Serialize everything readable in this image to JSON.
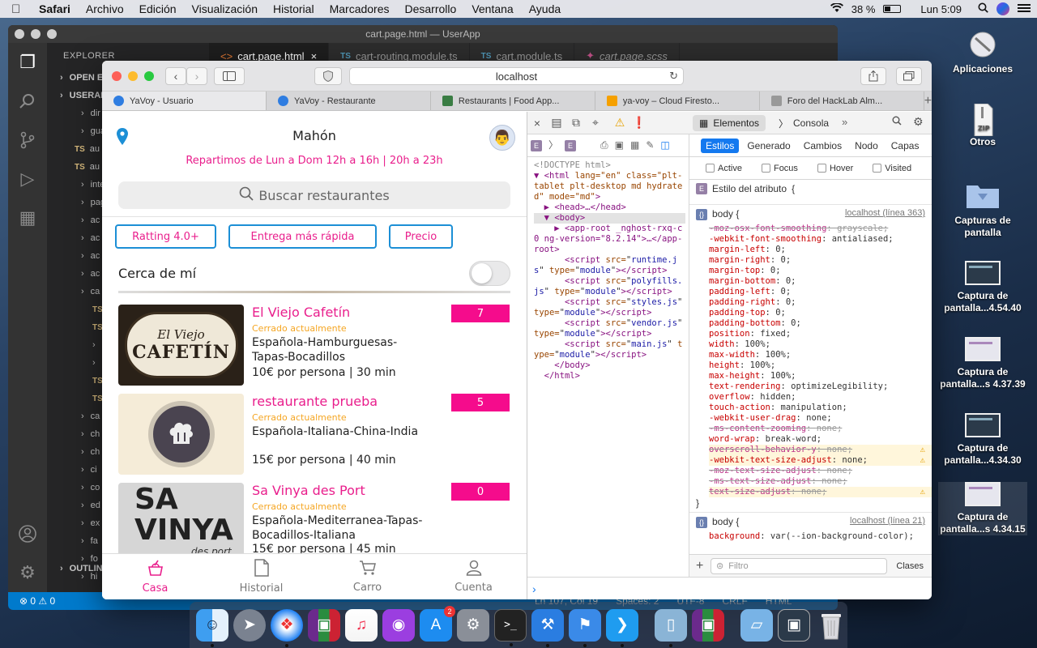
{
  "menubar": {
    "app": "Safari",
    "items": [
      "Archivo",
      "Edición",
      "Visualización",
      "Historial",
      "Marcadores",
      "Desarrollo",
      "Ventana",
      "Ayuda"
    ],
    "battery": "38 %",
    "clock": "Lun 5:09"
  },
  "desktop": {
    "icons": [
      {
        "label": "Aplicaciones"
      },
      {
        "label": "Otros"
      },
      {
        "label": "Capturas de pantalla"
      },
      {
        "label": "Captura de pantalla...4.54.40"
      },
      {
        "label": "Captura de pantalla...s 4.37.39"
      },
      {
        "label": "Captura de pantalla...4.34.30"
      },
      {
        "label": "Captura de pantalla...s 4.34.15"
      }
    ]
  },
  "vscode": {
    "title": "cart.page.html — UserApp",
    "explorer": "EXPLORER",
    "sidebar_rows": [
      "OPEN ED",
      "USERAP",
      "dir",
      "gua",
      "au",
      "au",
      "inte",
      "pag",
      "ac",
      "ac",
      "ac",
      "ac",
      "ca",
      "",
      "",
      "",
      "",
      "",
      "",
      "ca",
      "ch",
      "ch",
      "ci",
      "co",
      "ed",
      "ex",
      "fa",
      "fo",
      "hi",
      "OUTLINE"
    ],
    "tabs": [
      "cart.page.html",
      "cart-routing.module.ts",
      "cart.module.ts",
      "cart.page.scss"
    ],
    "status_left": "⊗ 0 ⚠ 0",
    "status_right": [
      "Ln 107, Col 19",
      "Spaces: 2",
      "UTF-8",
      "CRLF",
      "HTML"
    ]
  },
  "safari": {
    "url": "localhost",
    "tabs": [
      {
        "label": "YaVoy - Usuario",
        "color": "#2f7de1"
      },
      {
        "label": "YaVoy - Restaurante",
        "color": "#2f7de1"
      },
      {
        "label": "Restaurants | Food App...",
        "color": "#3a7d44"
      },
      {
        "label": "ya-voy – Cloud Firesto...",
        "color": "#f5a000"
      },
      {
        "label": "Foro del HackLab Alm...",
        "color": "#999999"
      }
    ]
  },
  "app": {
    "city": "Mahón",
    "hours": "Repartimos de Lun a Dom 12h a 16h | 20h a 23h",
    "search_placeholder": "Buscar restaurantes",
    "filters": [
      "Ratting 4.0+",
      "Entrega más rápida",
      "Precio"
    ],
    "near_me": "Cerca de mí",
    "near_me_on": false,
    "restaurants": [
      {
        "name": "El Viejo Cafetín",
        "status": "Cerrado actualmente",
        "cuisine": "Española-Hamburguesas-Tapas-Bocadillos",
        "price": "10€ por persona | 30 min",
        "badge": "7",
        "logo_line1": "El Viejo",
        "logo_line2": "CAFETÍN"
      },
      {
        "name": "restaurante prueba",
        "status": "Cerrado actualmente",
        "cuisine": "Española-Italiana-China-India",
        "price": "15€ por persona | 40 min",
        "badge": "5"
      },
      {
        "name": "Sa Vinya des Port",
        "status": "Cerrado actualmente",
        "cuisine": "Española-Mediterranea-Tapas-Bocadillos-Italiana",
        "price": "15€ por persona | 45 min",
        "badge": "0",
        "logo_line1": "SA",
        "logo_line2": "VINYA",
        "logo_line3": "des port"
      }
    ],
    "nav": [
      {
        "label": "Casa",
        "icon": "home-delivery-icon",
        "active": true
      },
      {
        "label": "Historial",
        "icon": "document-icon",
        "active": false
      },
      {
        "label": "Carro",
        "icon": "cart-icon",
        "active": false
      },
      {
        "label": "Cuenta",
        "icon": "user-icon",
        "active": false
      }
    ]
  },
  "devtools": {
    "elements_tab": "Elementos",
    "console_tab": "Consola",
    "subtabs": [
      "Estilos",
      "Generado",
      "Cambios",
      "Nodo",
      "Capas"
    ],
    "states": [
      "Active",
      "Focus",
      "Hover",
      "Visited"
    ],
    "attr_style": "Estilo del atributo",
    "filter_placeholder": "Filtro",
    "classes": "Clases",
    "dom": {
      "doctype": "<!DOCTYPE html>",
      "html_attrs": "lang=\"en\" class=\"plt-tablet plt-desktop md hydrated\" mode=\"md\"",
      "head": "<head>…</head>",
      "body": "<body>",
      "approot": "<app-root _nghost-rxq-c0 ng-version=\"8.2.14\">…</app-root>",
      "scripts": [
        "runtime.js",
        "polyfills.js",
        "styles.js",
        "vendor.js",
        "main.js"
      ],
      "body_close": "</body>",
      "html_close": "</html>"
    },
    "rule1": {
      "selector": "body",
      "source": "localhost (línea 363)",
      "props": [
        {
          "n": "-moz-osx-font-smoothing",
          "v": "grayscale",
          "strike": true
        },
        {
          "n": "-webkit-font-smoothing",
          "v": "antialiased"
        },
        {
          "n": "margin-left",
          "v": "0"
        },
        {
          "n": "margin-right",
          "v": "0"
        },
        {
          "n": "margin-top",
          "v": "0"
        },
        {
          "n": "margin-bottom",
          "v": "0"
        },
        {
          "n": "padding-left",
          "v": "0"
        },
        {
          "n": "padding-right",
          "v": "0"
        },
        {
          "n": "padding-top",
          "v": "0"
        },
        {
          "n": "padding-bottom",
          "v": "0"
        },
        {
          "n": "position",
          "v": "fixed"
        },
        {
          "n": "width",
          "v": "100%"
        },
        {
          "n": "max-width",
          "v": "100%"
        },
        {
          "n": "height",
          "v": "100%"
        },
        {
          "n": "max-height",
          "v": "100%"
        },
        {
          "n": "text-rendering",
          "v": "optimizeLegibility"
        },
        {
          "n": "overflow",
          "v": "hidden"
        },
        {
          "n": "touch-action",
          "v": "manipulation"
        },
        {
          "n": "-webkit-user-drag",
          "v": "none"
        },
        {
          "n": "-ms-content-zooming",
          "v": "none",
          "strike": true
        },
        {
          "n": "word-wrap",
          "v": "break-word"
        },
        {
          "n": "overscroll-behavior-y",
          "v": "none",
          "strike": true,
          "warn": true
        },
        {
          "n": "-webkit-text-size-adjust",
          "v": "none",
          "warn": true
        },
        {
          "n": "-moz-text-size-adjust",
          "v": "none",
          "strike": true
        },
        {
          "n": "-ms-text-size-adjust",
          "v": "none",
          "strike": true
        },
        {
          "n": "text-size-adjust",
          "v": "none",
          "strike": true,
          "warn": true
        }
      ]
    },
    "rule2": {
      "selector": "body",
      "source": "localhost (línea 21)",
      "props": [
        {
          "n": "background",
          "v": "var(--ion-background-color)"
        }
      ]
    }
  }
}
